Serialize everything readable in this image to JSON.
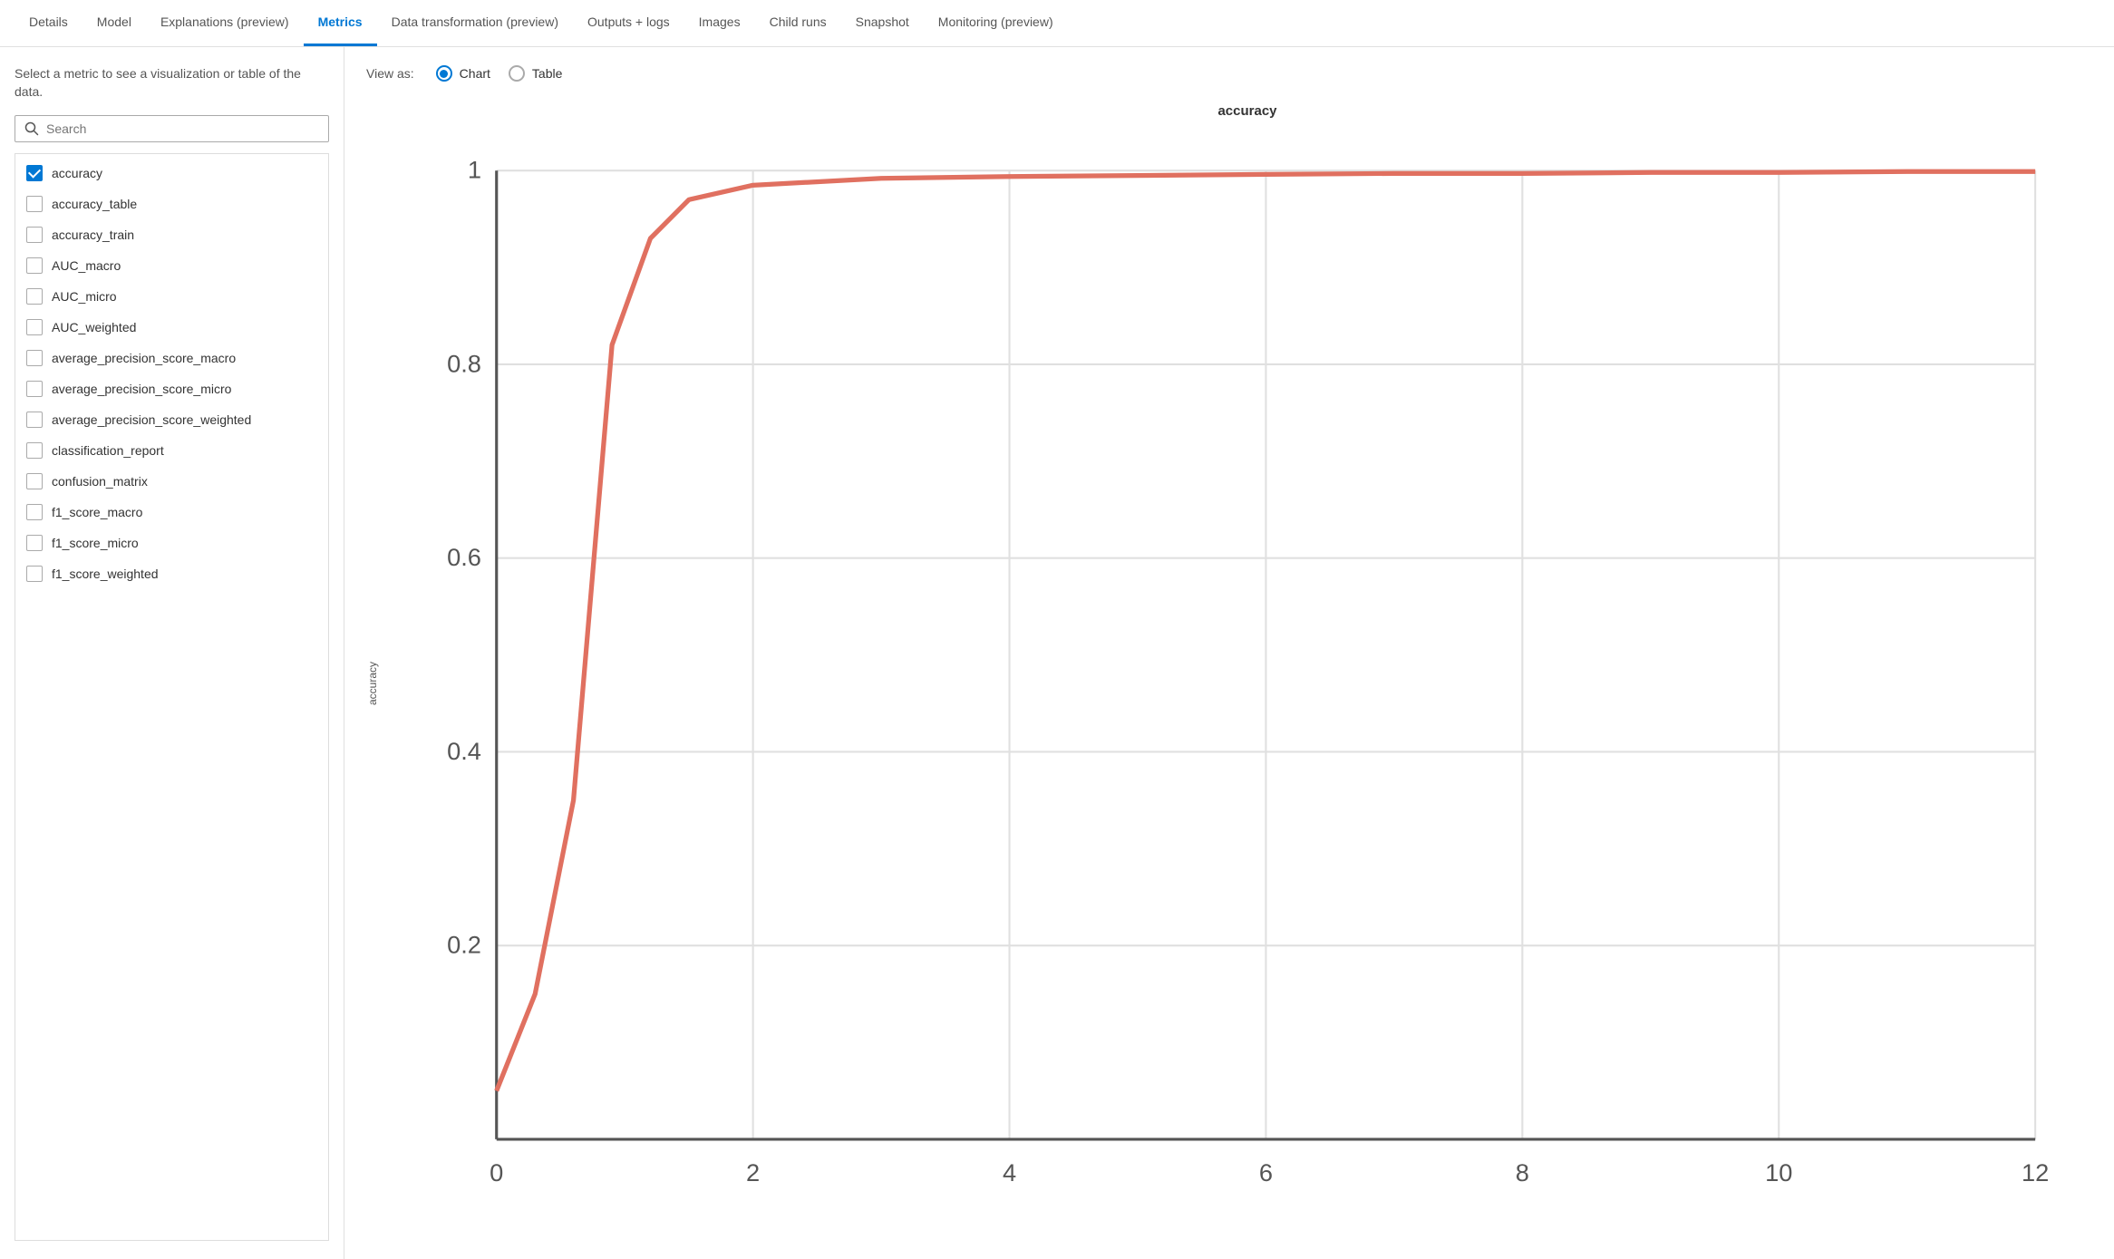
{
  "tabs": [
    {
      "id": "details",
      "label": "Details",
      "active": false
    },
    {
      "id": "model",
      "label": "Model",
      "active": false
    },
    {
      "id": "explanations",
      "label": "Explanations (preview)",
      "active": false
    },
    {
      "id": "metrics",
      "label": "Metrics",
      "active": true
    },
    {
      "id": "data-transformation",
      "label": "Data transformation (preview)",
      "active": false
    },
    {
      "id": "outputs-logs",
      "label": "Outputs + logs",
      "active": false
    },
    {
      "id": "images",
      "label": "Images",
      "active": false
    },
    {
      "id": "child-runs",
      "label": "Child runs",
      "active": false
    },
    {
      "id": "snapshot",
      "label": "Snapshot",
      "active": false
    },
    {
      "id": "monitoring",
      "label": "Monitoring (preview)",
      "active": false
    }
  ],
  "sidebar": {
    "description": "Select a metric to see a visualization or table of the data.",
    "search_placeholder": "Search",
    "metrics": [
      {
        "id": "accuracy",
        "label": "accuracy",
        "checked": true
      },
      {
        "id": "accuracy_table",
        "label": "accuracy_table",
        "checked": false
      },
      {
        "id": "accuracy_train",
        "label": "accuracy_train",
        "checked": false
      },
      {
        "id": "AUC_macro",
        "label": "AUC_macro",
        "checked": false
      },
      {
        "id": "AUC_micro",
        "label": "AUC_micro",
        "checked": false
      },
      {
        "id": "AUC_weighted",
        "label": "AUC_weighted",
        "checked": false
      },
      {
        "id": "average_precision_score_macro",
        "label": "average_precision_score_macro",
        "checked": false
      },
      {
        "id": "average_precision_score_micro",
        "label": "average_precision_score_micro",
        "checked": false
      },
      {
        "id": "average_precision_score_weighted",
        "label": "average_precision_score_weighted",
        "checked": false
      },
      {
        "id": "classification_report",
        "label": "classification_report",
        "checked": false
      },
      {
        "id": "confusion_matrix",
        "label": "confusion_matrix",
        "checked": false
      },
      {
        "id": "f1_score_macro",
        "label": "f1_score_macro",
        "checked": false
      },
      {
        "id": "f1_score_micro",
        "label": "f1_score_micro",
        "checked": false
      },
      {
        "id": "f1_score_weighted",
        "label": "f1_score_weighted",
        "checked": false
      }
    ]
  },
  "view_as": {
    "label": "View as:",
    "options": [
      {
        "id": "chart",
        "label": "Chart",
        "selected": true
      },
      {
        "id": "table",
        "label": "Table",
        "selected": false
      }
    ]
  },
  "chart": {
    "title": "accuracy",
    "y_axis_label": "accuracy",
    "x_axis_values": [
      "0",
      "2",
      "4",
      "6",
      "8",
      "10",
      "12"
    ],
    "y_axis_values": [
      "0.2",
      "0.4",
      "0.6",
      "0.8",
      "1"
    ],
    "line_color": "#e07060",
    "grid_color": "#e8e8e8",
    "axis_color": "#333"
  }
}
